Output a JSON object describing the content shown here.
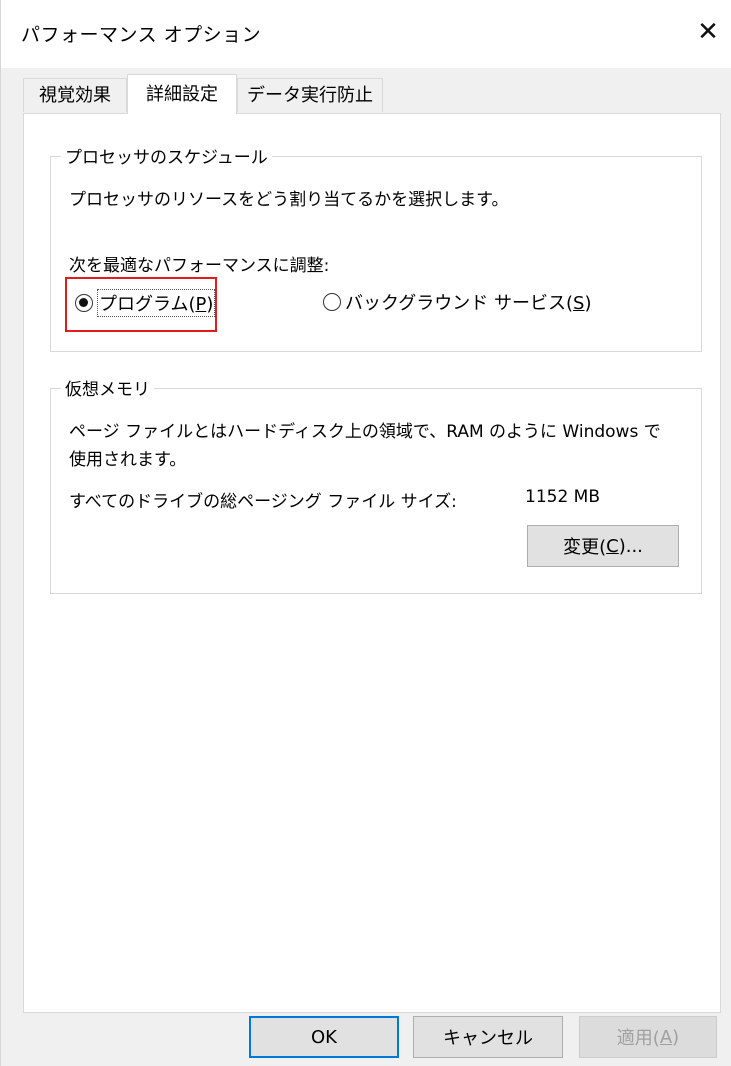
{
  "window": {
    "title": "パフォーマンス オプション",
    "close_glyph": "✕"
  },
  "tabs": [
    {
      "label": "視覚効果",
      "active": false
    },
    {
      "label": "詳細設定",
      "active": true
    },
    {
      "label": "データ実行防止",
      "active": false
    }
  ],
  "processor": {
    "group_label": "プロセッサのスケジュール",
    "description": "プロセッサのリソースをどう割り当てるかを選択します。",
    "adjust_label": "次を最適なパフォーマンスに調整:",
    "options": [
      {
        "label_main": "プログラム(",
        "mnemonic": "P",
        "label_end": ")",
        "checked": true
      },
      {
        "label_main": "バックグラウンド サービス(",
        "mnemonic": "S",
        "label_end": ")",
        "checked": false
      }
    ]
  },
  "virtual_memory": {
    "group_label": "仮想メモリ",
    "description_line1": "ページ ファイルとはハードディスク上の領域で、RAM のように Windows で",
    "description_line2": "使用されます。",
    "total_label": "すべてのドライブの総ページング ファイル サイズ:",
    "total_value": "1152 MB",
    "change_button": {
      "label_main": "変更(",
      "mnemonic": "C",
      "label_end": ")..."
    }
  },
  "footer": {
    "ok_label": "OK",
    "cancel_label": "キャンセル",
    "apply": {
      "label_main": "適用(",
      "mnemonic": "A",
      "label_end": ")"
    }
  },
  "colors": {
    "highlight_box": "#e21b1b",
    "default_button_border": "#0078d7"
  }
}
